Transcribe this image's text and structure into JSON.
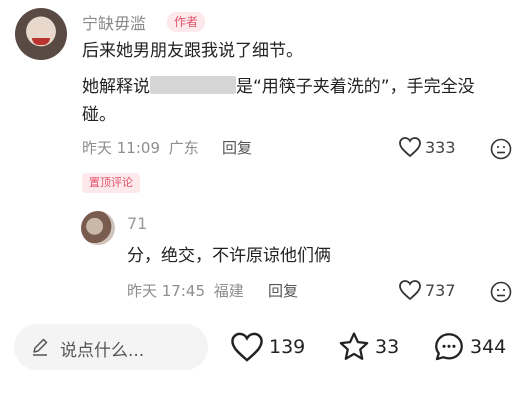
{
  "comment": {
    "username": "宁缺毋滥",
    "author_badge": "作者",
    "line1": "后来她男朋友跟我说了细节。",
    "line2a": "她解释说",
    "line2b": "是“用筷子夹着洗的”，手完全没",
    "line3": "碰。",
    "time": "昨天 11:09",
    "location": "广东",
    "reply_label": "回复",
    "likes": "333",
    "pin_badge": "置顶评论"
  },
  "reply": {
    "username": "71",
    "text": "分，绝交，不许原谅他们俩",
    "time": "昨天 17:45",
    "location": "福建",
    "reply_label": "回复",
    "likes": "737"
  },
  "bottom": {
    "input_placeholder": "说点什么...",
    "likes": "139",
    "stars": "33",
    "comments": "344"
  }
}
